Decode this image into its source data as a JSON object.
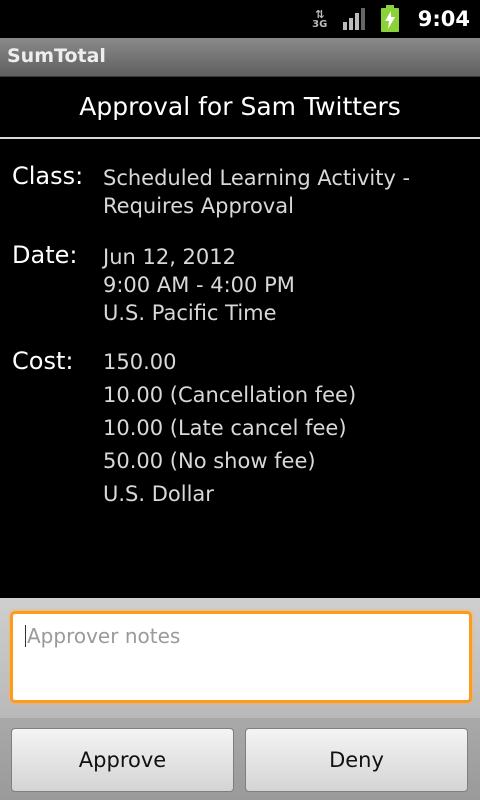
{
  "status_bar": {
    "network_type": "3G",
    "time": "9:04"
  },
  "app": {
    "title": "SumTotal"
  },
  "header": {
    "title": "Approval for Sam Twitters"
  },
  "details": {
    "class_label": "Class:",
    "class_lines": [
      "Scheduled Learning Activity -",
      "Requires Approval"
    ],
    "date_label": "Date:",
    "date_lines": [
      "Jun 12, 2012",
      "9:00 AM - 4:00 PM",
      "U.S. Pacific Time"
    ],
    "cost_label": "Cost:",
    "cost_lines": [
      "150.00",
      "10.00 (Cancellation fee)",
      "10.00 (Late cancel fee)",
      "50.00 (No show fee)",
      "U.S. Dollar"
    ]
  },
  "notes": {
    "placeholder": "Approver notes",
    "value": ""
  },
  "actions": {
    "approve_label": "Approve",
    "deny_label": "Deny"
  },
  "colors": {
    "focus_border": "#ff9a1c",
    "battery": "#8bd13a"
  }
}
